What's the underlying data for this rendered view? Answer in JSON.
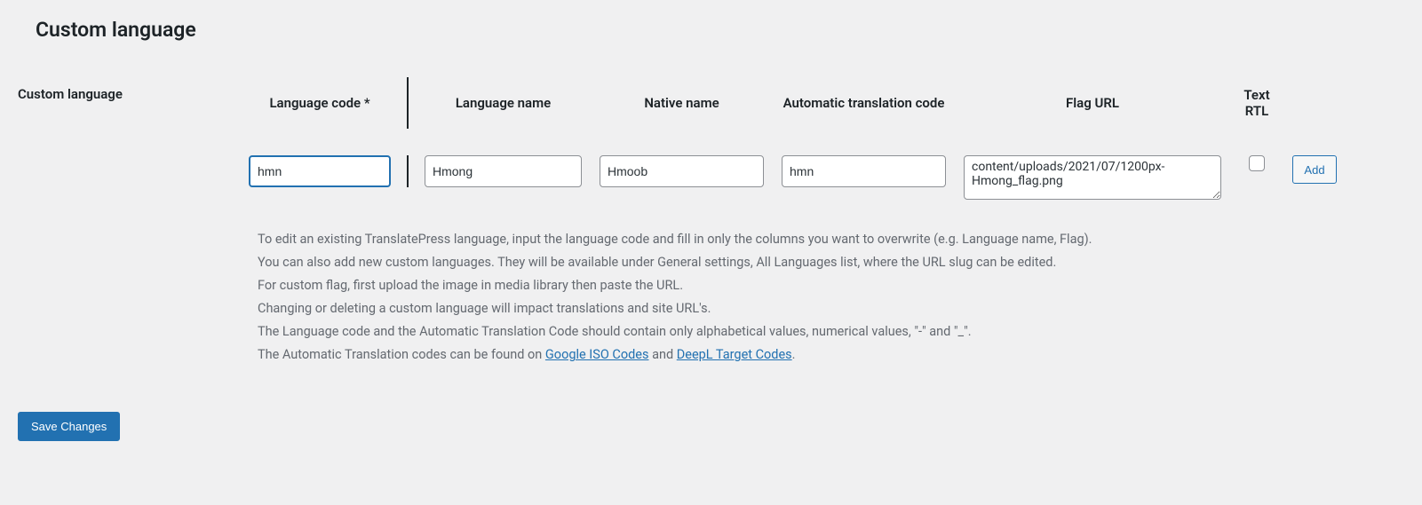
{
  "section": {
    "heading": "Custom language",
    "side_label": "Custom language"
  },
  "headers": {
    "code": "Language code *",
    "name": "Language name",
    "native": "Native name",
    "auto": "Automatic translation code",
    "flag": "Flag URL",
    "rtl": "Text RTL"
  },
  "fields": {
    "code": "hmn",
    "name": "Hmong",
    "native": "Hmoob",
    "auto": "hmn",
    "flag": "content/uploads/2021/07/1200px-Hmong_flag.png"
  },
  "buttons": {
    "add": "Add",
    "save": "Save Changes"
  },
  "help": {
    "line1": "To edit an existing TranslatePress language, input the language code and fill in only the columns you want to overwrite (e.g. Language name, Flag).",
    "line2": "You can also add new custom languages. They will be available under General settings, All Languages list, where the URL slug can be edited.",
    "line3": "For custom flag, first upload the image in media library then paste the URL.",
    "line4": "Changing or deleting a custom language will impact translations and site URL's.",
    "line5": "The Language code and the Automatic Translation Code should contain only alphabetical values, numerical values, \"-\" and \"_\".",
    "line6_a": "The Automatic Translation codes can be found on ",
    "line6_link1": "Google ISO Codes",
    "line6_b": " and ",
    "line6_link2": "DeepL Target Codes",
    "line6_c": "."
  }
}
